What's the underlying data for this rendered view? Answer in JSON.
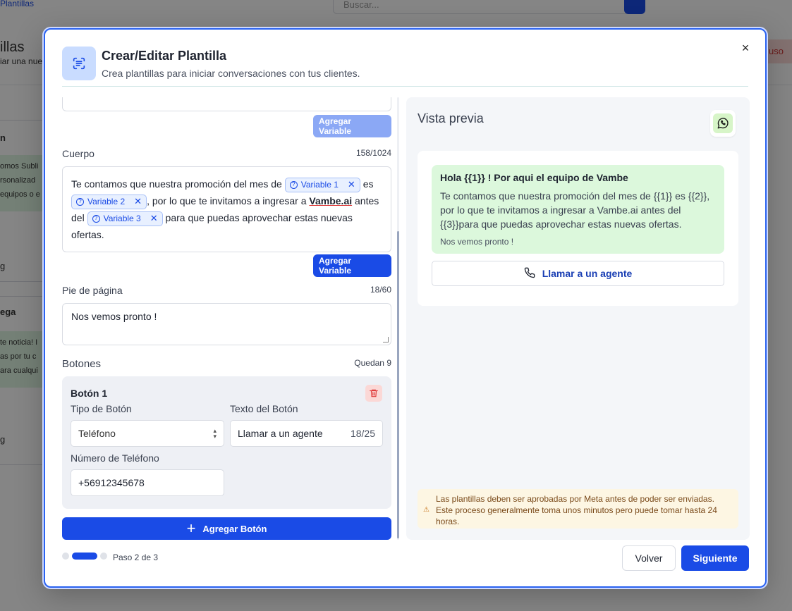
{
  "background": {
    "breadcrumb": "Plantillas",
    "search_placeholder": "Buscar...",
    "page_title": "illas",
    "page_sub": "iar una nue",
    "card1_title": "n",
    "card1_lines": [
      "omos Subli",
      "rsonalizad",
      "equipos o e"
    ],
    "card2_title": "ega",
    "card2_lines": [
      "te noticia! I",
      "as por tu c",
      "ara cualqui"
    ],
    "tag1": "g",
    "tag2": "g",
    "red_btn": "uso"
  },
  "modal": {
    "title": "Crear/Editar Plantilla",
    "subtitle": "Crea plantillas para iniciar conversaciones con tus clientes.",
    "close_label": "×",
    "header_variable_button": "Agregar Variable",
    "body": {
      "label": "Cuerpo",
      "count": "158/1024",
      "text_1": "Te contamos que nuestra promoción del mes de",
      "var_1": "Variable 1",
      "text_2": "es",
      "var_2": "Variable 2",
      "text_3": ", por lo que te invitamos a ingresar a",
      "link": "Vambe.ai",
      "text_4": "antes del",
      "var_3": "Variable 3",
      "text_5": "para que puedas aprovechar estas nuevas ofertas.",
      "add_variable": "Agregar Variable"
    },
    "footer": {
      "label": "Pie de página",
      "count": "18/60",
      "value": "Nos vemos pronto !"
    },
    "buttons": {
      "label": "Botones",
      "remaining": "Quedan 9",
      "item_title": "Botón 1",
      "type_label": "Tipo de Botón",
      "type_value": "Teléfono",
      "text_label": "Texto del Botón",
      "text_value": "Llamar a un agente",
      "text_count": "18/25",
      "phone_label": "Número de Teléfono",
      "phone_value": "+56912345678",
      "add_button": "Agregar Botón"
    },
    "steps": {
      "text": "Paso 2 de 3",
      "total": 3,
      "current": 2
    },
    "preview": {
      "title": "Vista previa",
      "header": "Hola {{1}} ! Por aqui el equipo de Vambe",
      "body": "Te contamos que nuestra promoción del mes de {{1}} es {{2}}, por lo que te invitamos a ingresar a Vambe.ai antes del {{3}}para que puedas aprovechar estas nuevas ofertas.",
      "footer": "Nos vemos pronto !",
      "call_button": "Llamar a un agente",
      "warning": "Las plantillas deben ser aprobadas por Meta antes de poder ser enviadas. Este proceso generalmente toma unos minutos pero puede tomar hasta 24 horas."
    },
    "back_button": "Volver",
    "next_button": "Siguiente"
  },
  "colors": {
    "primary": "#1a4be6",
    "bubble": "#dcf8dc",
    "warning_bg": "#fdf6e3"
  },
  "icons": [
    "template-icon",
    "close-icon",
    "question-icon",
    "remove-icon",
    "trash-icon",
    "plus-icon",
    "whatsapp-icon",
    "phone-icon",
    "warning-icon"
  ]
}
